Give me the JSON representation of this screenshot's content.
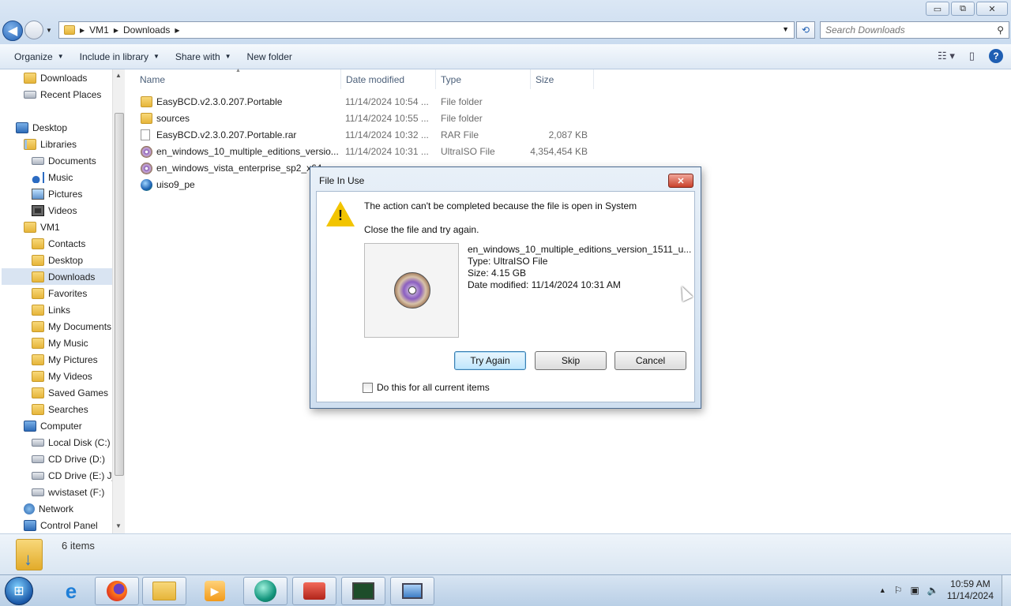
{
  "window": {
    "controls": {
      "minimize": "▭",
      "maximize": "⧉",
      "close": "✕"
    }
  },
  "address": {
    "crumbs": [
      "VM1",
      "Downloads"
    ],
    "search_placeholder": "Search Downloads"
  },
  "commandbar": {
    "organize": "Organize",
    "include_in_library": "Include in library",
    "share_with": "Share with",
    "new_folder": "New folder"
  },
  "navpane": {
    "items": [
      {
        "label": "Downloads",
        "icon": "folder-icon"
      },
      {
        "label": "Recent Places",
        "icon": "recent-places-icon"
      },
      {
        "label": "Desktop",
        "icon": "desktop-icon"
      },
      {
        "label": "Libraries",
        "icon": "libraries-icon"
      },
      {
        "label": "Documents",
        "icon": "documents-icon"
      },
      {
        "label": "Music",
        "icon": "music-icon"
      },
      {
        "label": "Pictures",
        "icon": "pictures-icon"
      },
      {
        "label": "Videos",
        "icon": "videos-icon"
      },
      {
        "label": "VM1",
        "icon": "user-folder-icon"
      },
      {
        "label": "Contacts",
        "icon": "folder-icon"
      },
      {
        "label": "Desktop",
        "icon": "folder-icon"
      },
      {
        "label": "Downloads",
        "icon": "folder-icon"
      },
      {
        "label": "Favorites",
        "icon": "folder-icon"
      },
      {
        "label": "Links",
        "icon": "folder-icon"
      },
      {
        "label": "My Documents",
        "icon": "folder-icon"
      },
      {
        "label": "My Music",
        "icon": "folder-icon"
      },
      {
        "label": "My Pictures",
        "icon": "folder-icon"
      },
      {
        "label": "My Videos",
        "icon": "folder-icon"
      },
      {
        "label": "Saved Games",
        "icon": "folder-icon"
      },
      {
        "label": "Searches",
        "icon": "folder-icon"
      },
      {
        "label": "Computer",
        "icon": "computer-icon"
      },
      {
        "label": "Local Disk (C:)",
        "icon": "drive-icon"
      },
      {
        "label": "CD Drive (D:)",
        "icon": "cd-drive-icon"
      },
      {
        "label": "CD Drive (E:) J_",
        "icon": "cd-drive-icon"
      },
      {
        "label": "wvistaset (F:)",
        "icon": "drive-icon"
      },
      {
        "label": "Network",
        "icon": "network-icon"
      },
      {
        "label": "Control Panel",
        "icon": "control-panel-icon"
      }
    ],
    "selected": "Downloads"
  },
  "filelist": {
    "columns": [
      "Name",
      "Date modified",
      "Type",
      "Size"
    ],
    "rows": [
      {
        "name": "EasyBCD.v2.3.0.207.Portable",
        "date": "11/14/2024 10:54 ...",
        "type": "File folder",
        "size": "",
        "icon": "folder-icon"
      },
      {
        "name": "sources",
        "date": "11/14/2024 10:55 ...",
        "type": "File folder",
        "size": "",
        "icon": "folder-icon"
      },
      {
        "name": "EasyBCD.v2.3.0.207.Portable.rar",
        "date": "11/14/2024 10:32 ...",
        "type": "RAR File",
        "size": "2,087 KB",
        "icon": "file-icon"
      },
      {
        "name": "en_windows_10_multiple_editions_versio...",
        "date": "11/14/2024 10:31 ...",
        "type": "UltraISO File",
        "size": "4,354,454 KB",
        "icon": "iso-icon"
      },
      {
        "name": "en_windows_vista_enterprise_sp2_x64",
        "date": "",
        "type": "",
        "size": "",
        "icon": "iso-icon"
      },
      {
        "name": "uiso9_pe",
        "date": "",
        "type": "",
        "size": "",
        "icon": "globe-icon"
      }
    ]
  },
  "status": {
    "item_count": "6 items"
  },
  "dialog": {
    "title": "File In Use",
    "message": "The action can't be completed because the file is open in System",
    "instruction": "Close the file and try again.",
    "file_name": "en_windows_10_multiple_editions_version_1511_u...",
    "file_type": "Type: UltraISO File",
    "file_size": "Size: 4.15 GB",
    "file_date": "Date modified: 11/14/2024 10:31 AM",
    "buttons": {
      "try_again": "Try Again",
      "skip": "Skip",
      "cancel": "Cancel"
    },
    "checkbox_label": "Do this for all current items",
    "checkbox_checked": false
  },
  "taskbar": {
    "clock_time": "10:59 AM",
    "clock_date": "11/14/2024"
  }
}
